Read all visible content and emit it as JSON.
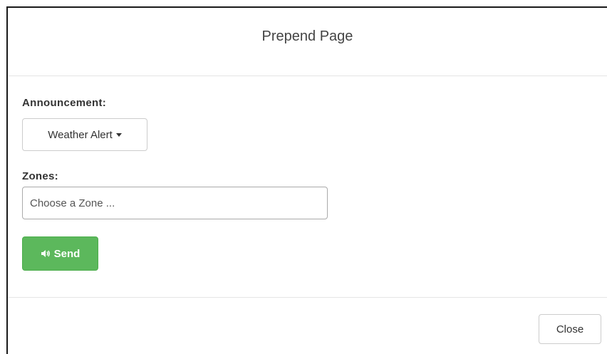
{
  "modal": {
    "title": "Prepend Page"
  },
  "announcement": {
    "label": "Announcement:",
    "selected": "Weather Alert"
  },
  "zones": {
    "label": "Zones:",
    "placeholder": "Choose a Zone ..."
  },
  "send_button": {
    "label": "Send",
    "icon": "volume-icon",
    "color": "#5cb85c"
  },
  "close_button": {
    "label": "Close"
  }
}
